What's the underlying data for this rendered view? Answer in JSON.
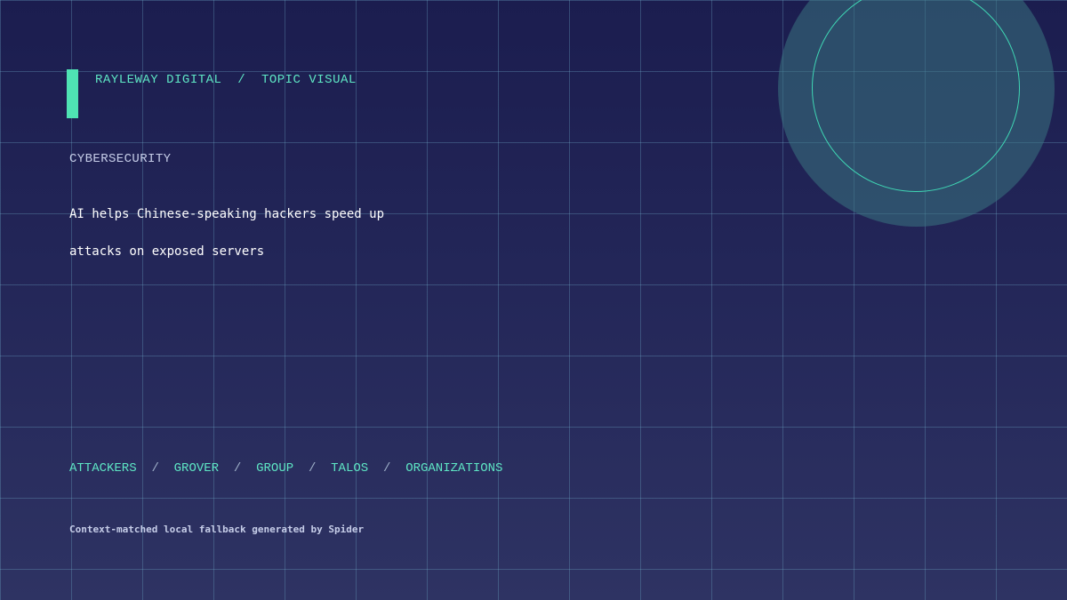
{
  "header": {
    "brand": "RAYLEWAY DIGITAL",
    "separator": "/",
    "section": "TOPIC VISUAL"
  },
  "category": "CYBERSECURITY",
  "headline": {
    "line1": "AI helps Chinese-speaking hackers speed up",
    "line2": "attacks on exposed servers"
  },
  "tags": [
    "ATTACKERS",
    "GROVER",
    "GROUP",
    "TALOS",
    "ORGANIZATIONS"
  ],
  "tag_separator": "/",
  "footer": "Context-matched local fallback generated by Spider",
  "colors": {
    "accent": "#4fe3b3",
    "background_top": "#1b1d4f",
    "background_bottom": "#2e3363",
    "orb": "#3c7882"
  }
}
